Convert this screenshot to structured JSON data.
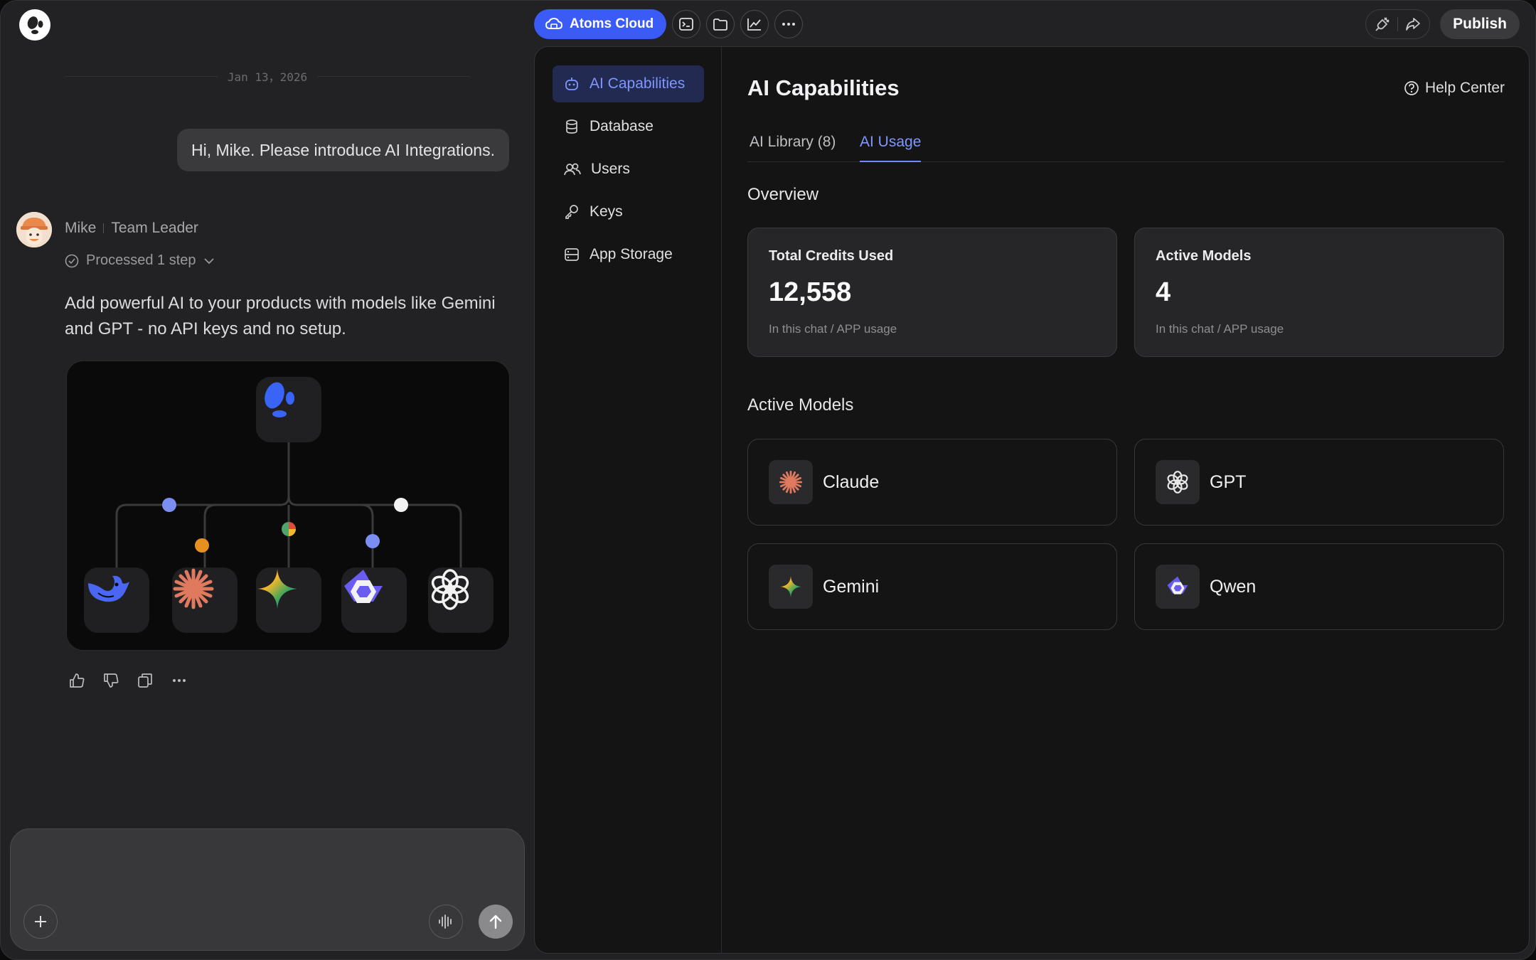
{
  "topbar": {
    "cloud_label": "Atoms Cloud",
    "publish_label": "Publish",
    "icons": [
      "terminal-icon",
      "folder-icon",
      "chart-icon",
      "more-icon",
      "plug-icon",
      "share-icon"
    ]
  },
  "chat": {
    "date": "Jan 13，2026",
    "user_message": "Hi, Mike. Please introduce AI Integrations.",
    "agent_name": "Mike",
    "agent_role": "Team Leader",
    "processed": "Processed 1 step",
    "intro": "Add powerful AI to your products with models like Gemini and GPT - no API keys and no setup.",
    "composer_placeholder": ""
  },
  "panel": {
    "nav": [
      {
        "label": "AI Capabilities",
        "icon": "robot-icon",
        "active": true
      },
      {
        "label": "Database",
        "icon": "database-icon"
      },
      {
        "label": "Users",
        "icon": "users-icon"
      },
      {
        "label": "Keys",
        "icon": "key-icon"
      },
      {
        "label": "App Storage",
        "icon": "storage-icon"
      }
    ],
    "title": "AI Capabilities",
    "help": "Help Center",
    "tabs": [
      {
        "label": "AI Library (8)"
      },
      {
        "label": "AI Usage",
        "active": true
      }
    ],
    "overview_label": "Overview",
    "stats": [
      {
        "title": "Total Credits Used",
        "value": "12,558",
        "sub": "In this chat / APP usage"
      },
      {
        "title": "Active Models",
        "value": "4",
        "sub": "In this chat / APP usage"
      }
    ],
    "active_models_label": "Active Models",
    "models": [
      {
        "name": "Claude",
        "icon": "claude-icon"
      },
      {
        "name": "GPT",
        "icon": "openai-icon"
      },
      {
        "name": "Gemini",
        "icon": "gemini-icon"
      },
      {
        "name": "Qwen",
        "icon": "qwen-icon"
      }
    ]
  },
  "colors": {
    "accent": "#3b5bf6",
    "accent_text": "#7e97ff",
    "claude": "#e07a5f",
    "dot_orange": "#e8901f"
  }
}
